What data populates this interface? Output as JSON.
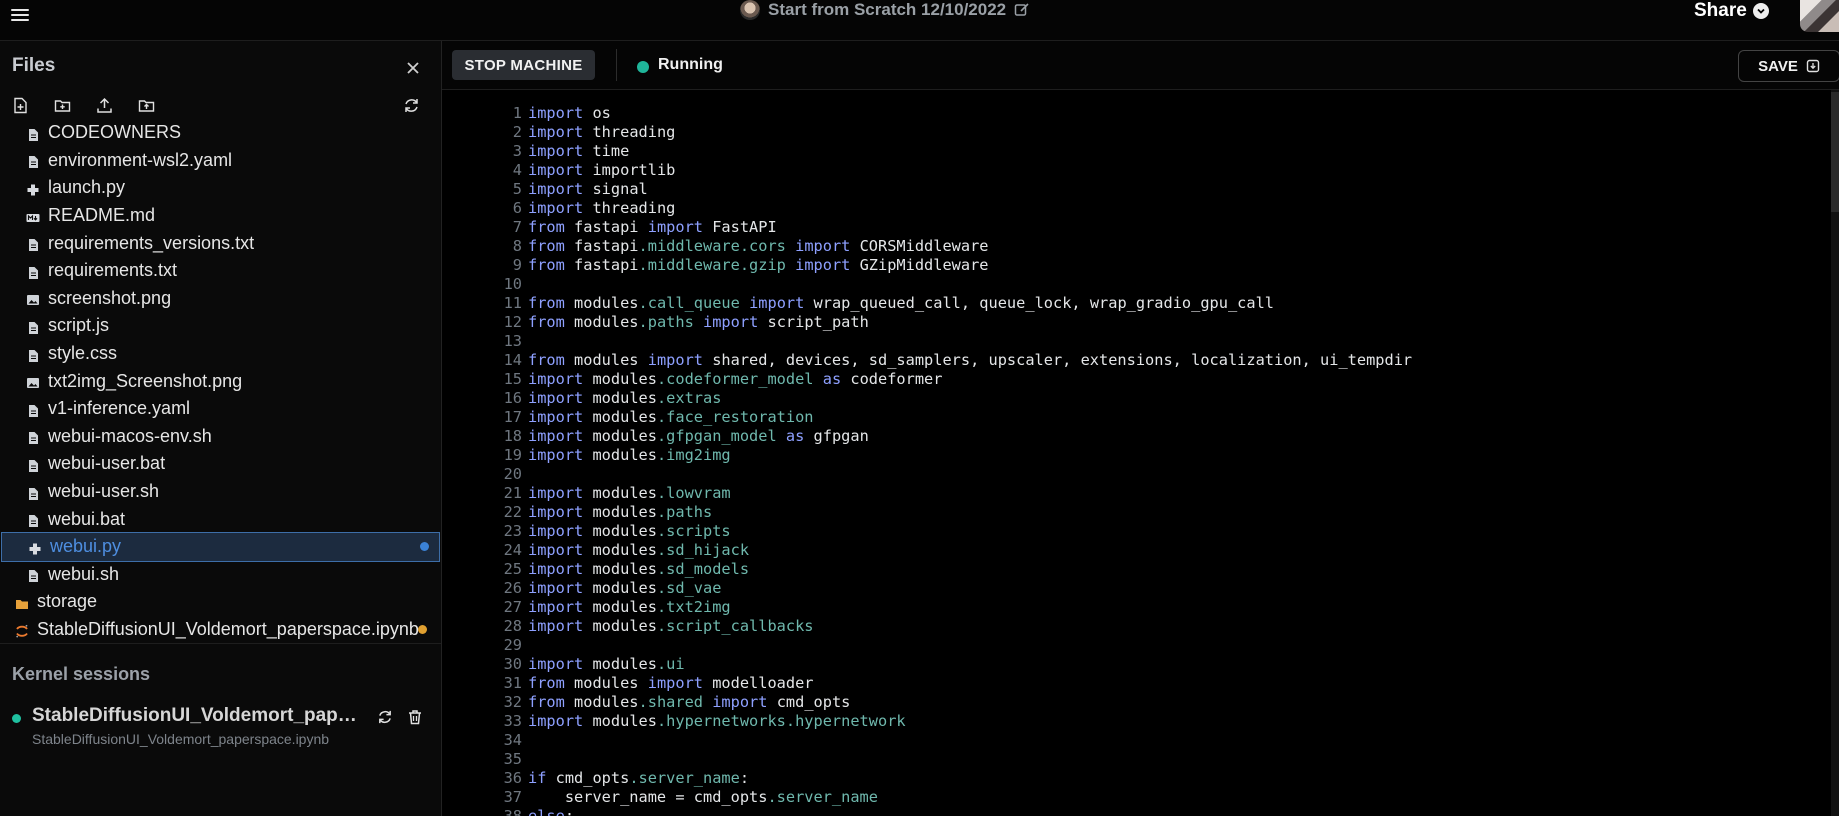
{
  "header": {
    "title": "Start from Scratch 12/10/2022",
    "share_label": "Share"
  },
  "sidebar": {
    "title": "Files",
    "files": [
      {
        "name": "CODEOWNERS",
        "icon": "file-icon"
      },
      {
        "name": "environment-wsl2.yaml",
        "icon": "file-icon"
      },
      {
        "name": "launch.py",
        "icon": "python-icon"
      },
      {
        "name": "README.md",
        "icon": "markdown-icon"
      },
      {
        "name": "requirements_versions.txt",
        "icon": "file-icon"
      },
      {
        "name": "requirements.txt",
        "icon": "file-icon"
      },
      {
        "name": "screenshot.png",
        "icon": "image-icon"
      },
      {
        "name": "script.js",
        "icon": "file-icon"
      },
      {
        "name": "style.css",
        "icon": "file-icon"
      },
      {
        "name": "txt2img_Screenshot.png",
        "icon": "image-icon"
      },
      {
        "name": "v1-inference.yaml",
        "icon": "file-icon"
      },
      {
        "name": "webui-macos-env.sh",
        "icon": "file-icon"
      },
      {
        "name": "webui-user.bat",
        "icon": "file-icon"
      },
      {
        "name": "webui-user.sh",
        "icon": "file-icon"
      },
      {
        "name": "webui.bat",
        "icon": "file-icon"
      },
      {
        "name": "webui.py",
        "icon": "python-icon",
        "selected": true,
        "dot": "#3b82d6"
      },
      {
        "name": "webui.sh",
        "icon": "file-icon"
      },
      {
        "name": "storage",
        "icon": "folder-icon",
        "folder": true
      },
      {
        "name": "StableDiffusionUI_Voldemort_paperspace.ipynb",
        "icon": "jupyter-icon",
        "folder": true,
        "dot": "#e0a030"
      }
    ],
    "kernel": {
      "title": "Kernel sessions",
      "name": "StableDiffusionUI_Voldemort_paper...",
      "file": "StableDiffusionUI_Voldemort_paperspace.ipynb"
    }
  },
  "toolbar": {
    "stop_label": "STOP MACHINE",
    "status": "Running",
    "save_label": "SAVE"
  },
  "code": [
    [
      [
        "k",
        "import"
      ],
      [
        "t",
        " os"
      ]
    ],
    [
      [
        "k",
        "import"
      ],
      [
        "t",
        " threading"
      ]
    ],
    [
      [
        "k",
        "import"
      ],
      [
        "t",
        " time"
      ]
    ],
    [
      [
        "k",
        "import"
      ],
      [
        "t",
        " importlib"
      ]
    ],
    [
      [
        "k",
        "import"
      ],
      [
        "t",
        " signal"
      ]
    ],
    [
      [
        "k",
        "import"
      ],
      [
        "t",
        " threading"
      ]
    ],
    [
      [
        "k",
        "from"
      ],
      [
        "t",
        " fastapi "
      ],
      [
        "k",
        "import"
      ],
      [
        "t",
        " FastAPI"
      ]
    ],
    [
      [
        "k",
        "from"
      ],
      [
        "t",
        " fastapi"
      ],
      [
        "m",
        ".middleware.cors"
      ],
      [
        "t",
        " "
      ],
      [
        "k",
        "import"
      ],
      [
        "t",
        " CORSMiddleware"
      ]
    ],
    [
      [
        "k",
        "from"
      ],
      [
        "t",
        " fastapi"
      ],
      [
        "m",
        ".middleware.gzip"
      ],
      [
        "t",
        " "
      ],
      [
        "k",
        "import"
      ],
      [
        "t",
        " GZipMiddleware"
      ]
    ],
    [],
    [
      [
        "k",
        "from"
      ],
      [
        "t",
        " modules"
      ],
      [
        "m",
        ".call_queue"
      ],
      [
        "t",
        " "
      ],
      [
        "k",
        "import"
      ],
      [
        "t",
        " wrap_queued_call, queue_lock, wrap_gradio_gpu_call"
      ]
    ],
    [
      [
        "k",
        "from"
      ],
      [
        "t",
        " modules"
      ],
      [
        "m",
        ".paths"
      ],
      [
        "t",
        " "
      ],
      [
        "k",
        "import"
      ],
      [
        "t",
        " script_path"
      ]
    ],
    [],
    [
      [
        "k",
        "from"
      ],
      [
        "t",
        " modules "
      ],
      [
        "k",
        "import"
      ],
      [
        "t",
        " shared, devices, sd_samplers, upscaler, extensions, localization, ui_tempdir"
      ]
    ],
    [
      [
        "k",
        "import"
      ],
      [
        "t",
        " modules"
      ],
      [
        "m",
        ".codeformer_model"
      ],
      [
        "t",
        " "
      ],
      [
        "k",
        "as"
      ],
      [
        "t",
        " codeformer"
      ]
    ],
    [
      [
        "k",
        "import"
      ],
      [
        "t",
        " modules"
      ],
      [
        "m",
        ".extras"
      ]
    ],
    [
      [
        "k",
        "import"
      ],
      [
        "t",
        " modules"
      ],
      [
        "m",
        ".face_restoration"
      ]
    ],
    [
      [
        "k",
        "import"
      ],
      [
        "t",
        " modules"
      ],
      [
        "m",
        ".gfpgan_model"
      ],
      [
        "t",
        " "
      ],
      [
        "k",
        "as"
      ],
      [
        "t",
        " gfpgan"
      ]
    ],
    [
      [
        "k",
        "import"
      ],
      [
        "t",
        " modules"
      ],
      [
        "m",
        ".img2img"
      ]
    ],
    [],
    [
      [
        "k",
        "import"
      ],
      [
        "t",
        " modules"
      ],
      [
        "m",
        ".lowvram"
      ]
    ],
    [
      [
        "k",
        "import"
      ],
      [
        "t",
        " modules"
      ],
      [
        "m",
        ".paths"
      ]
    ],
    [
      [
        "k",
        "import"
      ],
      [
        "t",
        " modules"
      ],
      [
        "m",
        ".scripts"
      ]
    ],
    [
      [
        "k",
        "import"
      ],
      [
        "t",
        " modules"
      ],
      [
        "m",
        ".sd_hijack"
      ]
    ],
    [
      [
        "k",
        "import"
      ],
      [
        "t",
        " modules"
      ],
      [
        "m",
        ".sd_models"
      ]
    ],
    [
      [
        "k",
        "import"
      ],
      [
        "t",
        " modules"
      ],
      [
        "m",
        ".sd_vae"
      ]
    ],
    [
      [
        "k",
        "import"
      ],
      [
        "t",
        " modules"
      ],
      [
        "m",
        ".txt2img"
      ]
    ],
    [
      [
        "k",
        "import"
      ],
      [
        "t",
        " modules"
      ],
      [
        "m",
        ".script_callbacks"
      ]
    ],
    [],
    [
      [
        "k",
        "import"
      ],
      [
        "t",
        " modules"
      ],
      [
        "m",
        ".ui"
      ]
    ],
    [
      [
        "k",
        "from"
      ],
      [
        "t",
        " modules "
      ],
      [
        "k",
        "import"
      ],
      [
        "t",
        " modelloader"
      ]
    ],
    [
      [
        "k",
        "from"
      ],
      [
        "t",
        " modules"
      ],
      [
        "m",
        ".shared"
      ],
      [
        "t",
        " "
      ],
      [
        "k",
        "import"
      ],
      [
        "t",
        " cmd_opts"
      ]
    ],
    [
      [
        "k",
        "import"
      ],
      [
        "t",
        " modules"
      ],
      [
        "m",
        ".hypernetworks.hypernetwork"
      ]
    ],
    [],
    [],
    [
      [
        "k",
        "if"
      ],
      [
        "t",
        " cmd_opts"
      ],
      [
        "m",
        ".server_name"
      ],
      [
        "t",
        ":"
      ]
    ],
    [
      [
        "t",
        "    server_name = cmd_opts"
      ],
      [
        "m",
        ".server_name"
      ]
    ],
    [
      [
        "k",
        "else"
      ],
      [
        "t",
        ":"
      ]
    ]
  ]
}
